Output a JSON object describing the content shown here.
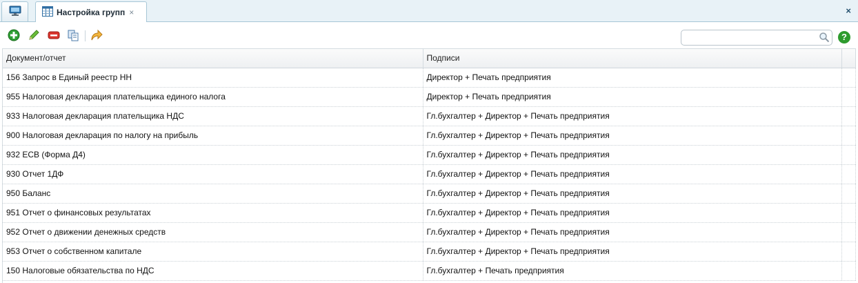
{
  "tabs": {
    "home_icon": "monitor-icon",
    "active": {
      "label": "Настройка групп",
      "icon": "table-icon",
      "close": "×"
    }
  },
  "panel_close": "×",
  "toolbar": {
    "icons": [
      "add-icon",
      "edit-icon",
      "delete-icon",
      "copy-icon",
      "forward-icon"
    ],
    "search_placeholder": "",
    "help": "?"
  },
  "grid": {
    "columns": [
      "Документ/отчет",
      "Подписи"
    ],
    "rows": [
      {
        "doc": "156 Запрос в Единый реестр НН",
        "sign": "Директор + Печать предприятия"
      },
      {
        "doc": "955 Налоговая декларация плательщика единого налога",
        "sign": "Директор + Печать предприятия"
      },
      {
        "doc": "933 Налоговая декларация плательщика НДС",
        "sign": "Гл.бухгалтер + Директор + Печать предприятия"
      },
      {
        "doc": "900 Налоговая декларация по налогу на прибыль",
        "sign": "Гл.бухгалтер + Директор + Печать предприятия"
      },
      {
        "doc": "932 ЕСВ (Форма Д4)",
        "sign": "Гл.бухгалтер + Директор + Печать предприятия"
      },
      {
        "doc": "930 Отчет 1ДФ",
        "sign": "Гл.бухгалтер + Директор + Печать предприятия"
      },
      {
        "doc": "950 Баланс",
        "sign": "Гл.бухгалтер + Директор + Печать предприятия"
      },
      {
        "doc": "951 Отчет о финансовых результатах",
        "sign": "Гл.бухгалтер + Директор + Печать предприятия"
      },
      {
        "doc": "952 Отчет о движении денежных средств",
        "sign": "Гл.бухгалтер + Директор + Печать предприятия"
      },
      {
        "doc": "953 Отчет о собственном капитале",
        "sign": "Гл.бухгалтер + Директор + Печать предприятия"
      },
      {
        "doc": "150 Налоговые обязательства по НДС",
        "sign": "Гл.бухгалтер + Печать предприятия"
      }
    ]
  }
}
